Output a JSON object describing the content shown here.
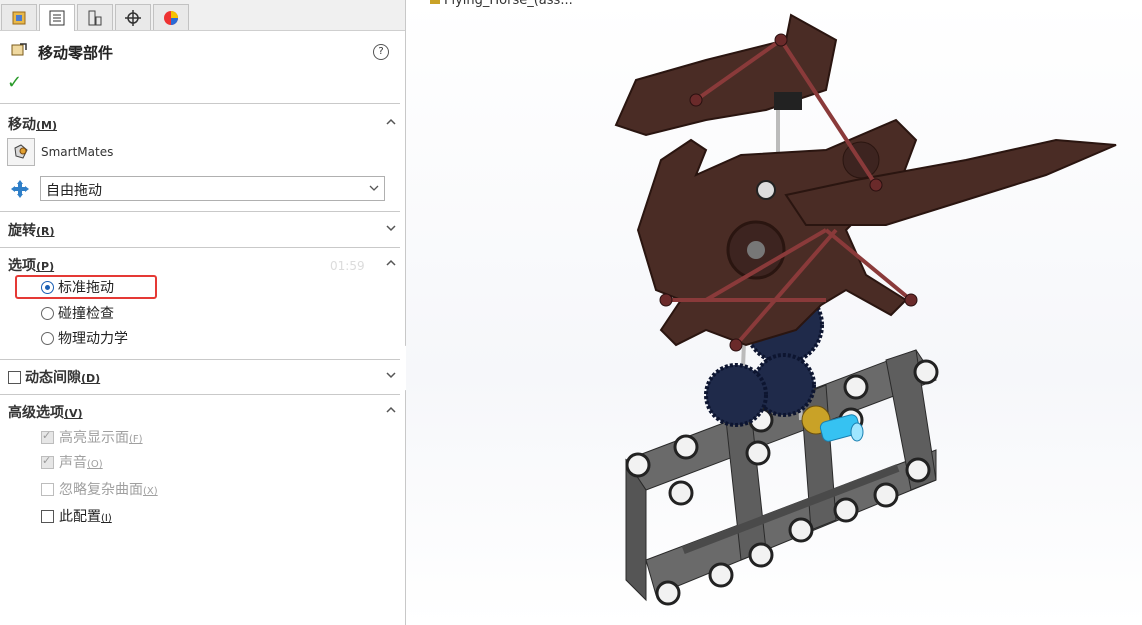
{
  "panel": {
    "title": "移动零部件",
    "help": "?",
    "ok": "✓",
    "sections": {
      "move": {
        "label": "移动",
        "accel": "(M)"
      },
      "rotate": {
        "label": "旋转",
        "accel": "(R)"
      },
      "options": {
        "label": "选项",
        "accel": "(P)"
      },
      "dynamic": {
        "label": "动态间隙",
        "accel": "(D)"
      },
      "advanced": {
        "label": "高级选项",
        "accel": "(V)"
      }
    },
    "smartmates_label": "SmartMates",
    "move_mode": "自由拖动",
    "timer": "01:59",
    "options": [
      {
        "label": "标准拖动",
        "selected": true
      },
      {
        "label": "碰撞检查",
        "selected": false
      },
      {
        "label": "物理动力学",
        "selected": false
      }
    ],
    "advanced": [
      {
        "label": "高亮显示面",
        "accel": "(F)",
        "checked": true,
        "disabled": true
      },
      {
        "label": "声音",
        "accel": "(O)",
        "checked": true,
        "disabled": true
      },
      {
        "label": "忽略复杂曲面",
        "accel": "(X)",
        "checked": false,
        "disabled": true
      },
      {
        "label": "此配置",
        "accel": "(I)",
        "checked": false,
        "disabled": false
      }
    ]
  },
  "viewport": {
    "tree_label": "Flying_Horse_(ass..."
  },
  "colors": {
    "accent": "#1a5fb4",
    "highlight_box": "#e53935",
    "ok_green": "#2a9a2a",
    "wood": "#4a2c25",
    "frame": "#5a5a5a",
    "gear": "#1f2a4a"
  }
}
